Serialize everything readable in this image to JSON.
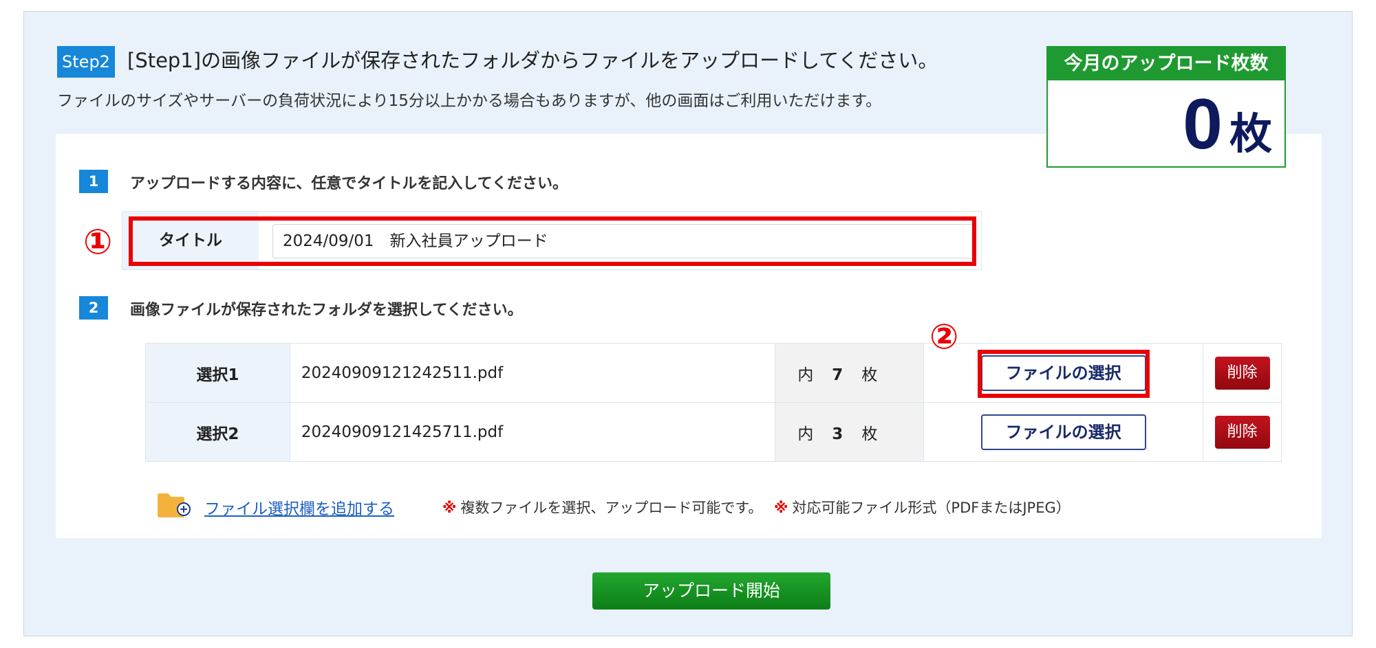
{
  "step": {
    "badge": "Step2",
    "title": "[Step1]の画像ファイルが保存されたフォルダからファイルをアップロードしてください。",
    "subtitle": "ファイルのサイズやサーバーの負荷状況により15分以上かかる場合もありますが、他の画面はご利用いただけます。"
  },
  "counter": {
    "heading": "今月のアップロード枚数",
    "value": "0",
    "unit": "枚"
  },
  "section1": {
    "number": "1",
    "title": "アップロードする内容に、任意でタイトルを記入してください。",
    "field_label": "タイトル",
    "field_value": "2024/09/01　新入社員アップロード"
  },
  "section2": {
    "number": "2",
    "title": "画像ファイルが保存されたフォルダを選択してください。"
  },
  "files": [
    {
      "label": "選択1",
      "filename": "20240909121242511.pdf",
      "count_prefix": "内",
      "count": "7",
      "count_unit": "枚",
      "choose_label": "ファイルの選択",
      "delete_label": "削除"
    },
    {
      "label": "選択2",
      "filename": "20240909121425711.pdf",
      "count_prefix": "内",
      "count": "3",
      "count_unit": "枚",
      "choose_label": "ファイルの選択",
      "delete_label": "削除"
    }
  ],
  "add_row": {
    "link": "ファイル選択欄を追加する",
    "note_mark": "※",
    "note1": "複数ファイルを選択、アップロード可能です。",
    "note2": "対応可能ファイル形式（PDFまたはJPEG）"
  },
  "annotations": {
    "marker1": "①",
    "marker2": "②",
    "color": "#ea0000"
  },
  "upload_button": "アップロード開始",
  "icons": {
    "folder": "folder-add-icon"
  }
}
